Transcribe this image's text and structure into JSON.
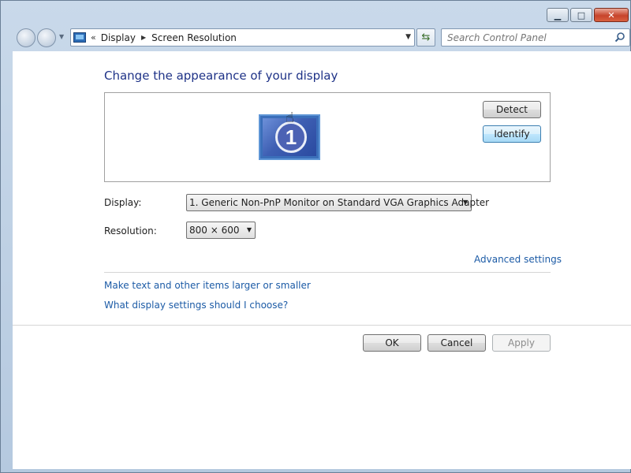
{
  "window": {
    "minimize_icon": "minimize-icon",
    "maximize_icon": "maximize-icon",
    "close_icon": "close-icon"
  },
  "nav": {
    "breadcrumb_chevron": "«",
    "breadcrumb": [
      "Display",
      "Screen Resolution"
    ],
    "search_placeholder": "Search Control Panel"
  },
  "main": {
    "title": "Change the appearance of your display",
    "monitor_number": "1",
    "detect_label": "Detect",
    "identify_label": "Identify",
    "display_label": "Display:",
    "display_value": "1. Generic Non-PnP Monitor on Standard VGA Graphics Adapter",
    "resolution_label": "Resolution:",
    "resolution_value": "800 × 600",
    "advanced_link": "Advanced settings",
    "link_text_size": "Make text and other items larger or smaller",
    "link_help": "What display settings should I choose?"
  },
  "footer": {
    "ok_label": "OK",
    "cancel_label": "Cancel",
    "apply_label": "Apply"
  },
  "colors": {
    "title": "#1e3287",
    "link": "#1c5ba6",
    "close_button": "#c7442c"
  }
}
